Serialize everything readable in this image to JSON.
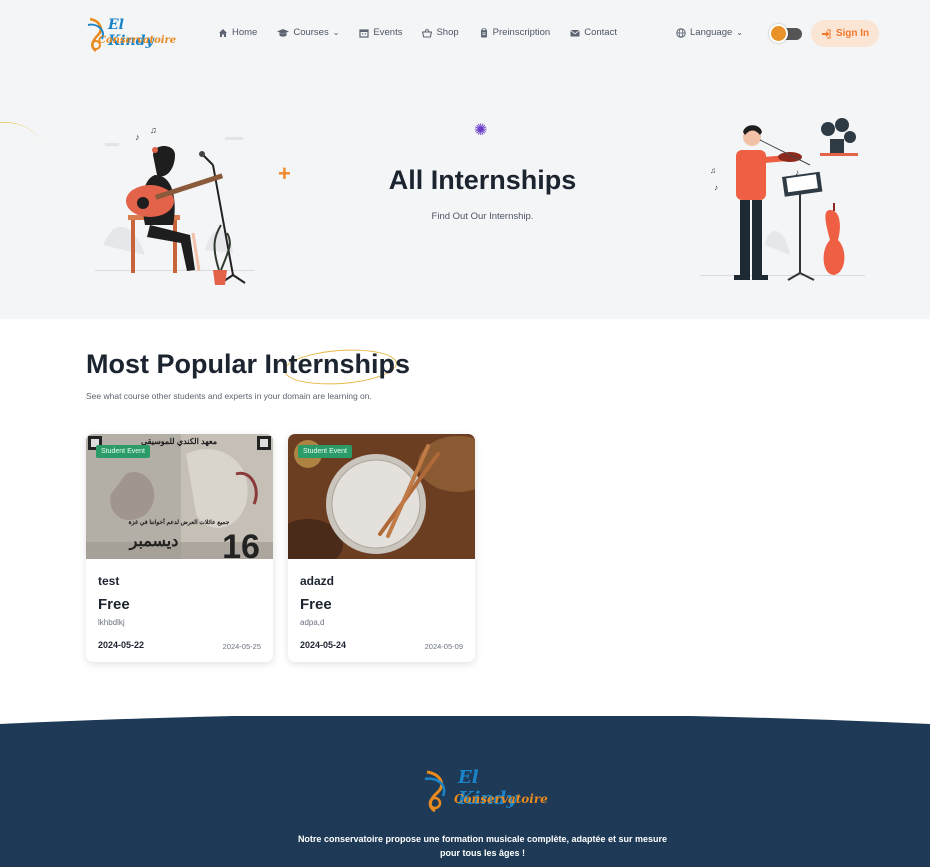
{
  "brand": {
    "line1": "El Kindy",
    "line2": "Conservatoire"
  },
  "nav": {
    "items": [
      {
        "label": "Home",
        "icon": "home-icon"
      },
      {
        "label": "Courses",
        "icon": "graduation-cap-icon",
        "dropdown": true
      },
      {
        "label": "Events",
        "icon": "calendar-icon"
      },
      {
        "label": "Shop",
        "icon": "basket-icon"
      },
      {
        "label": "Preinscription",
        "icon": "clipboard-icon"
      },
      {
        "label": "Contact",
        "icon": "envelope-icon"
      }
    ],
    "language_label": "Language",
    "signin_label": "Sign In"
  },
  "hero": {
    "title": "All Internships",
    "subtitle": "Find Out Our Internship."
  },
  "popular": {
    "title": "Most Popular Internships",
    "subtitle": "See what course other students and experts in your domain are learning on."
  },
  "cards": [
    {
      "badge": "Student Event",
      "title": "test",
      "price": "Free",
      "description": "lkhbdlkj",
      "start_date": "2024-05-22",
      "end_date": "2024-05-25",
      "poster_text": [
        "معهد الكندي للموسيقى",
        "جميع عائلات العرض لدعم أخواننا في غزة",
        "16",
        "ديسمبر"
      ]
    },
    {
      "badge": "Student Event",
      "title": "adazd",
      "price": "Free",
      "description": "adpa,d",
      "start_date": "2024-05-24",
      "end_date": "2024-05-09"
    }
  ],
  "footer": {
    "brand_line1": "El Kindy",
    "brand_line2": "Conservatoire",
    "text_line1": "Notre conservatoire propose une formation musicale complète, adaptée et sur mesure",
    "text_line2": "pour tous les âges !"
  },
  "colors": {
    "accent": "#f0782d",
    "badge": "#2b9b67",
    "footer": "#1e3a56",
    "hero_bg": "#f4f5f7"
  }
}
